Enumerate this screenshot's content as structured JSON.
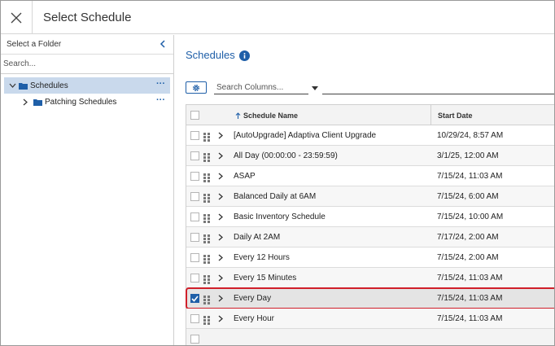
{
  "header": {
    "title": "Select Schedule"
  },
  "folders": {
    "heading": "Select a Folder",
    "search_placeholder": "Search...",
    "items": [
      {
        "label": "Schedules",
        "expanded": true,
        "selected": true,
        "more": "···"
      },
      {
        "label": "Patching Schedules",
        "expanded": false,
        "selected": false,
        "more": "···"
      }
    ]
  },
  "schedules": {
    "title": "Schedules",
    "column_search_placeholder": "Search Columns...",
    "columns": {
      "name": "Schedule Name",
      "start_date": "Start Date"
    },
    "rows": [
      {
        "name": "[AutoUpgrade] Adaptiva Client Upgrade",
        "start_date": "10/29/24, 8:57 AM",
        "checked": false
      },
      {
        "name": "All Day (00:00:00 - 23:59:59)",
        "start_date": "3/1/25, 12:00 AM",
        "checked": false
      },
      {
        "name": "ASAP",
        "start_date": "7/15/24, 11:03 AM",
        "checked": false
      },
      {
        "name": "Balanced Daily at 6AM",
        "start_date": "7/15/24, 6:00 AM",
        "checked": false
      },
      {
        "name": "Basic Inventory Schedule",
        "start_date": "7/15/24, 10:00 AM",
        "checked": false
      },
      {
        "name": "Daily At 2AM",
        "start_date": "7/17/24, 2:00 AM",
        "checked": false
      },
      {
        "name": "Every 12 Hours",
        "start_date": "7/15/24, 2:00 AM",
        "checked": false
      },
      {
        "name": "Every 15 Minutes",
        "start_date": "7/15/24, 11:03 AM",
        "checked": false
      },
      {
        "name": "Every Day",
        "start_date": "7/15/24, 11:03 AM",
        "checked": true
      },
      {
        "name": "Every Hour",
        "start_date": "7/15/24, 11:03 AM",
        "checked": false
      }
    ]
  },
  "colors": {
    "accent": "#1f5fa8",
    "selection_outline": "#d01f2a",
    "tree_selected": "#c9d9ec"
  },
  "icons": {
    "close": "close-icon",
    "collapse": "chevron-left-icon",
    "folder": "folder-icon",
    "info": "info-icon",
    "settings": "gear-icon",
    "dropdown": "caret-down-icon",
    "sort": "sort-ascending-icon",
    "drag": "drag-handle-icon",
    "expand": "chevron-right-icon"
  }
}
